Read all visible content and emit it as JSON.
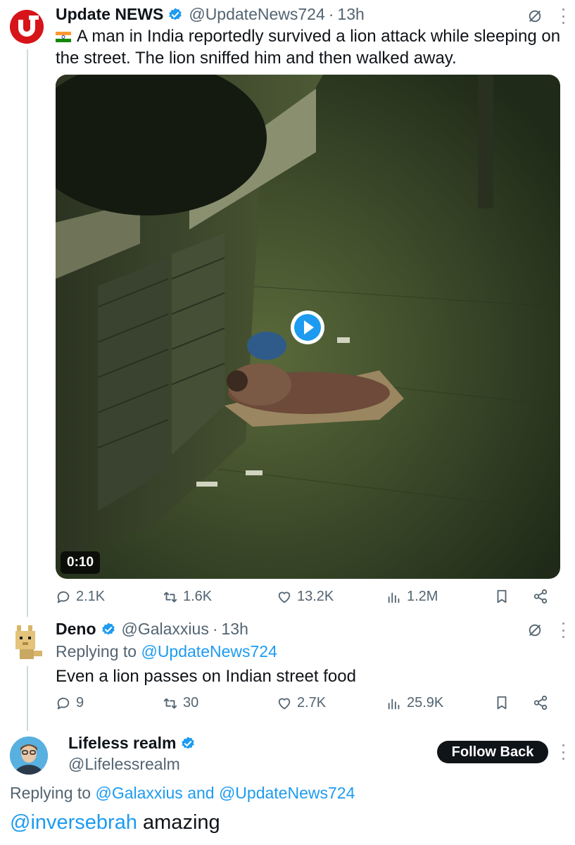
{
  "tweet": {
    "author_name": "Update NEWS",
    "handle": "@UpdateNews724",
    "separator": "·",
    "time": "13h",
    "text": "A man in India reportedly survived a lion attack while sleeping on the street. The lion sniffed him and then walked away.",
    "video_duration": "0:10",
    "stats": {
      "replies": "2.1K",
      "reposts": "1.6K",
      "likes": "13.2K",
      "views": "1.2M"
    }
  },
  "reply1": {
    "author_name": "Deno",
    "handle": "@Galaxxius",
    "separator": "·",
    "time": "13h",
    "replying_prefix": "Replying to",
    "replying_to": "@UpdateNews724",
    "text": "Even a lion passes on Indian street food",
    "stats": {
      "replies": "9",
      "reposts": "30",
      "likes": "2.7K",
      "views": "25.9K"
    }
  },
  "reply2": {
    "author_name": "Lifeless realm",
    "handle": "@Lifelessrealm",
    "follow_label": "Follow Back",
    "replying_prefix": "Replying to",
    "replying_to": "@Galaxxius and @UpdateNews724",
    "mention": "@inversebrah",
    "text": " amazing"
  },
  "icons": {
    "verified": "verified-badge-icon",
    "grok": "grok-icon",
    "more": "more-icon",
    "reply": "reply-icon",
    "repost": "repost-icon",
    "like": "heart-icon",
    "views": "views-icon",
    "bookmark": "bookmark-icon",
    "share": "share-icon",
    "play": "play-icon"
  },
  "colors": {
    "accent": "#1d9bf0",
    "muted": "#536471",
    "text": "#0f1419",
    "brand_red": "#d7141a"
  }
}
